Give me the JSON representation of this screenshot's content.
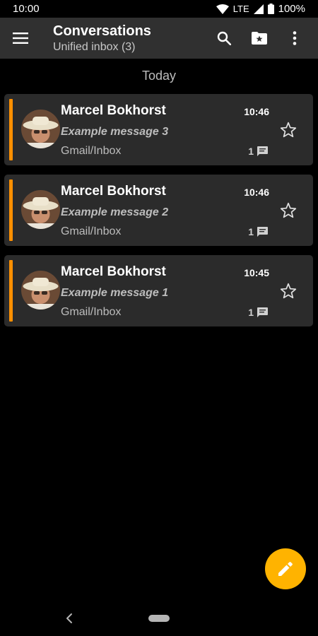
{
  "status_bar": {
    "time": "10:00",
    "network": "LTE",
    "battery": "100%"
  },
  "app_bar": {
    "title": "Conversations",
    "subtitle": "Unified inbox (3)",
    "icons": [
      "menu-icon",
      "search-icon",
      "folder-star-icon",
      "more-vert-icon"
    ]
  },
  "section": {
    "header": "Today"
  },
  "messages": [
    {
      "sender": "Marcel Bokhorst",
      "subject": "Example message 3",
      "folder": "Gmail/Inbox",
      "time": "10:46",
      "count": "1"
    },
    {
      "sender": "Marcel Bokhorst",
      "subject": "Example message 2",
      "folder": "Gmail/Inbox",
      "time": "10:46",
      "count": "1"
    },
    {
      "sender": "Marcel Bokhorst",
      "subject": "Example message 1",
      "folder": "Gmail/Inbox",
      "time": "10:45",
      "count": "1"
    }
  ],
  "colors": {
    "accent": "#ff8f00",
    "fab": "#ffb300",
    "card": "#2b2b2b",
    "app_bar": "#303030"
  },
  "fab": {
    "icon": "edit-pencil-icon"
  }
}
